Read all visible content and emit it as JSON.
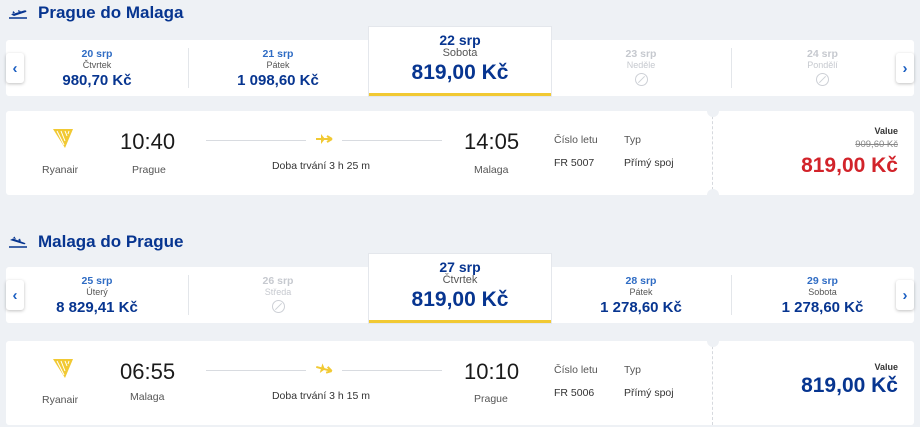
{
  "colors": {
    "brand_blue": "#073590",
    "link_blue": "#2f6cc4",
    "accent_yellow": "#f1c933",
    "sale_red": "#d2232a"
  },
  "outbound": {
    "title": "Prague do Malaga",
    "days": [
      {
        "date": "20 srp",
        "weekday": "Čtvrtek",
        "price": "980,70 Kč"
      },
      {
        "date": "21 srp",
        "weekday": "Pátek",
        "price": "1 098,60 Kč"
      },
      {
        "date": "22 srp",
        "weekday": "Sobota",
        "price": "819,00 Kč"
      },
      {
        "date": "23 srp",
        "weekday": "Neděle",
        "price": ""
      },
      {
        "date": "24 srp",
        "weekday": "Pondělí",
        "price": ""
      }
    ],
    "flight": {
      "airline": "Ryanair",
      "dep_time": "10:40",
      "dep_city": "Prague",
      "arr_time": "14:05",
      "arr_city": "Malaga",
      "duration": "Doba trvání 3 h 25 m",
      "flight_no_label": "Číslo letu",
      "flight_no": "FR 5007",
      "type_label": "Typ",
      "type": "Přímý spoj",
      "price_label": "Value",
      "old_price": "909,60 Kč",
      "price": "819,00 Kč"
    }
  },
  "inbound": {
    "title": "Malaga do Prague",
    "days": [
      {
        "date": "25 srp",
        "weekday": "Úterý",
        "price": "8 829,41 Kč"
      },
      {
        "date": "26 srp",
        "weekday": "Středa",
        "price": ""
      },
      {
        "date": "27 srp",
        "weekday": "Čtvrtek",
        "price": "819,00 Kč"
      },
      {
        "date": "28 srp",
        "weekday": "Pátek",
        "price": "1 278,60 Kč"
      },
      {
        "date": "29 srp",
        "weekday": "Sobota",
        "price": "1 278,60 Kč"
      }
    ],
    "flight": {
      "airline": "Ryanair",
      "dep_time": "06:55",
      "dep_city": "Malaga",
      "arr_time": "10:10",
      "arr_city": "Prague",
      "duration": "Doba trvání 3 h 15 m",
      "flight_no_label": "Číslo letu",
      "flight_no": "FR 5006",
      "type_label": "Typ",
      "type": "Přímý spoj",
      "price_label": "Value",
      "price": "819,00 Kč"
    }
  }
}
